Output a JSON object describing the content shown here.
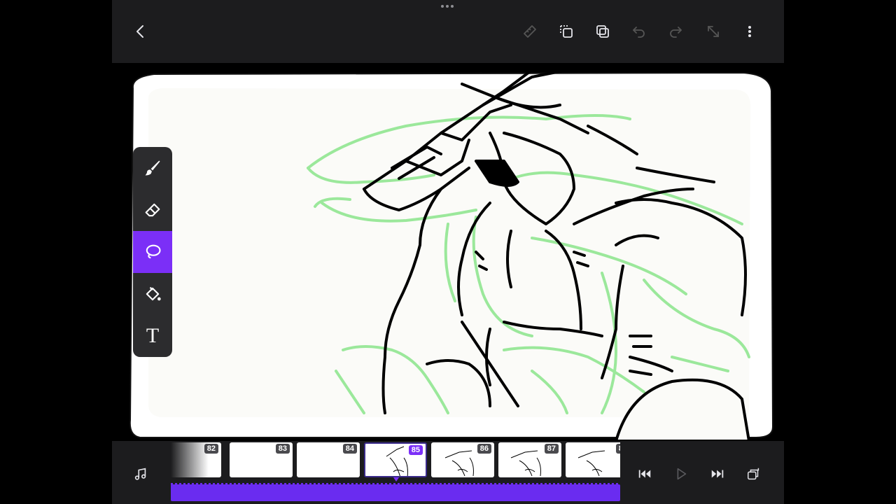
{
  "toolbar": {
    "back_icon": "chevron-left-icon",
    "actions": [
      "ruler-icon",
      "copy-frame-icon",
      "duplicate-icon",
      "undo-icon",
      "redo-icon",
      "transform-icon",
      "more-vertical-icon"
    ]
  },
  "tools": [
    {
      "name": "brush",
      "icon": "brush-icon",
      "active": false
    },
    {
      "name": "eraser",
      "icon": "eraser-icon",
      "active": false
    },
    {
      "name": "lasso",
      "icon": "lasso-icon",
      "active": true
    },
    {
      "name": "fill",
      "icon": "paint-bucket-icon",
      "active": false
    },
    {
      "name": "text",
      "icon": "text-icon",
      "glyph": "T",
      "active": false
    }
  ],
  "timeline": {
    "frames": [
      {
        "number": "82",
        "has_drawing": false
      },
      {
        "number": "83",
        "has_drawing": false
      },
      {
        "number": "84",
        "has_drawing": false
      },
      {
        "number": "85",
        "has_drawing": true,
        "active": true
      },
      {
        "number": "86",
        "has_drawing": true
      },
      {
        "number": "87",
        "has_drawing": true
      },
      {
        "number": "8",
        "has_drawing": true
      }
    ]
  },
  "bottombar": {
    "music_icon": "music-note-icon",
    "controls": [
      "skip-back-icon",
      "play-icon",
      "skip-forward-icon",
      "layers-icon"
    ]
  },
  "colors": {
    "accent": "#7b2ff7",
    "background": "#1c1c1e",
    "onion_skin": "#9be89b",
    "ink": "#000000"
  }
}
